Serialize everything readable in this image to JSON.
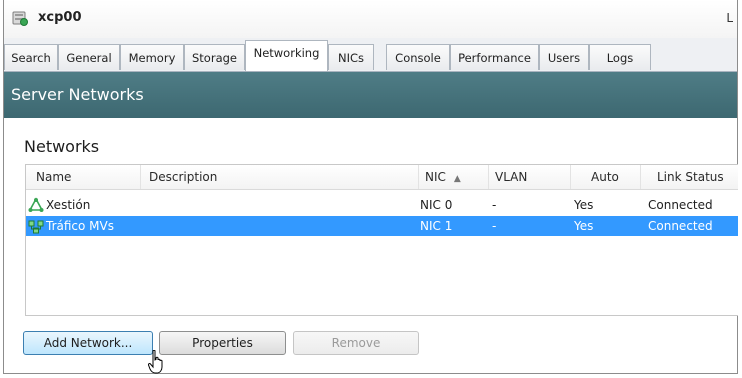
{
  "window": {
    "title": "xcp00",
    "title_edge": "L"
  },
  "tabs": [
    {
      "label": "Search"
    },
    {
      "label": "General"
    },
    {
      "label": "Memory"
    },
    {
      "label": "Storage"
    },
    {
      "label": "Networking"
    },
    {
      "label": "NICs"
    },
    {
      "label": "Console"
    },
    {
      "label": "Performance"
    },
    {
      "label": "Users"
    },
    {
      "label": "Logs"
    }
  ],
  "active_tab": "Networking",
  "banner": {
    "title": "Server Networks"
  },
  "networks": {
    "title": "Networks",
    "columns": [
      "Name",
      "Description",
      "NIC",
      "VLAN",
      "Auto",
      "Link Status"
    ],
    "sort_column": "NIC",
    "sort_direction": "ascending",
    "rows": [
      {
        "name": "Xestión",
        "description": "",
        "nic": "NIC 0",
        "vlan": "-",
        "auto": "Yes",
        "link_status": "Connected",
        "selected": false
      },
      {
        "name": "Tráfico MVs",
        "description": "",
        "nic": "NIC 1",
        "vlan": "-",
        "auto": "Yes",
        "link_status": "Connected",
        "selected": true
      }
    ]
  },
  "buttons": {
    "add_network": "Add Network...",
    "properties": "Properties",
    "remove": "Remove"
  },
  "colors": {
    "banner": "#42707a",
    "selection": "#3399ff",
    "network_icon": "#3aa655"
  }
}
